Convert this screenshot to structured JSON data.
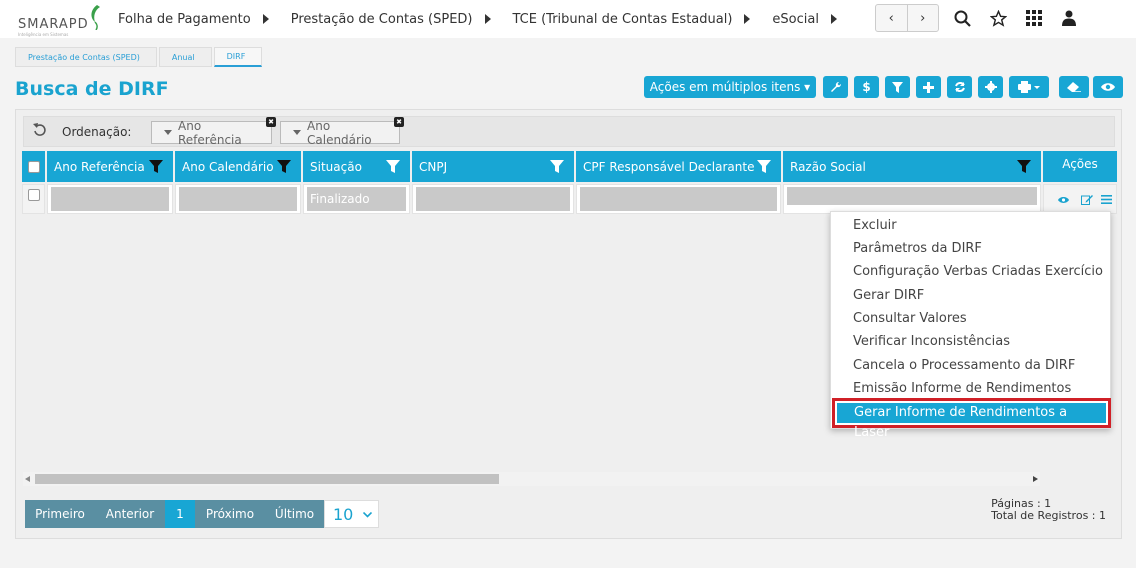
{
  "logo": {
    "text": "SMARAPD",
    "subtext": "Inteligência em Sistemas"
  },
  "topnav": {
    "items": [
      {
        "label": "Folha de Pagamento"
      },
      {
        "label": "Prestação de Contas (SPED)"
      },
      {
        "label": "TCE (Tribunal de Contas Estadual)"
      },
      {
        "label": "eSocial"
      }
    ],
    "prev": "‹",
    "next": "›"
  },
  "breadcrumb": [
    "Prestação de Contas (SPED)",
    "Anual",
    "DIRF"
  ],
  "page": {
    "title": "Busca de DIRF"
  },
  "toolbar": {
    "bulk_label": "Ações em múltiplos itens ▾",
    "dollar": "$"
  },
  "sort": {
    "label": "Ordenação:",
    "chips": [
      "Ano Referência",
      "Ano Calendário"
    ]
  },
  "table": {
    "columns": [
      "Ano Referência",
      "Ano Calendário",
      "Situação",
      "CNPJ",
      "CPF Responsável Declarante",
      "Razão Social",
      "Ações"
    ],
    "row": {
      "situacao": "Finalizado"
    }
  },
  "context_menu": {
    "items": [
      "Excluir",
      "Parâmetros da DIRF",
      "Configuração Verbas Criadas Exercício",
      "Gerar DIRF",
      "Consultar Valores",
      "Verificar Inconsistências",
      "Cancela o Processamento da DIRF",
      "Emissão Informe de Rendimentos"
    ],
    "highlighted": "Gerar Informe de Rendimentos a Laser"
  },
  "pagination": {
    "first": "Primeiro",
    "prev": "Anterior",
    "current": "1",
    "next": "Próximo",
    "last": "Último",
    "per_page": "10",
    "pages_label": "Páginas : 1",
    "total_label": "Total de Registros : 1"
  },
  "colors": {
    "accent": "#18a6d4",
    "pager": "#5a8fa2",
    "highlight_border": "#d02027"
  }
}
